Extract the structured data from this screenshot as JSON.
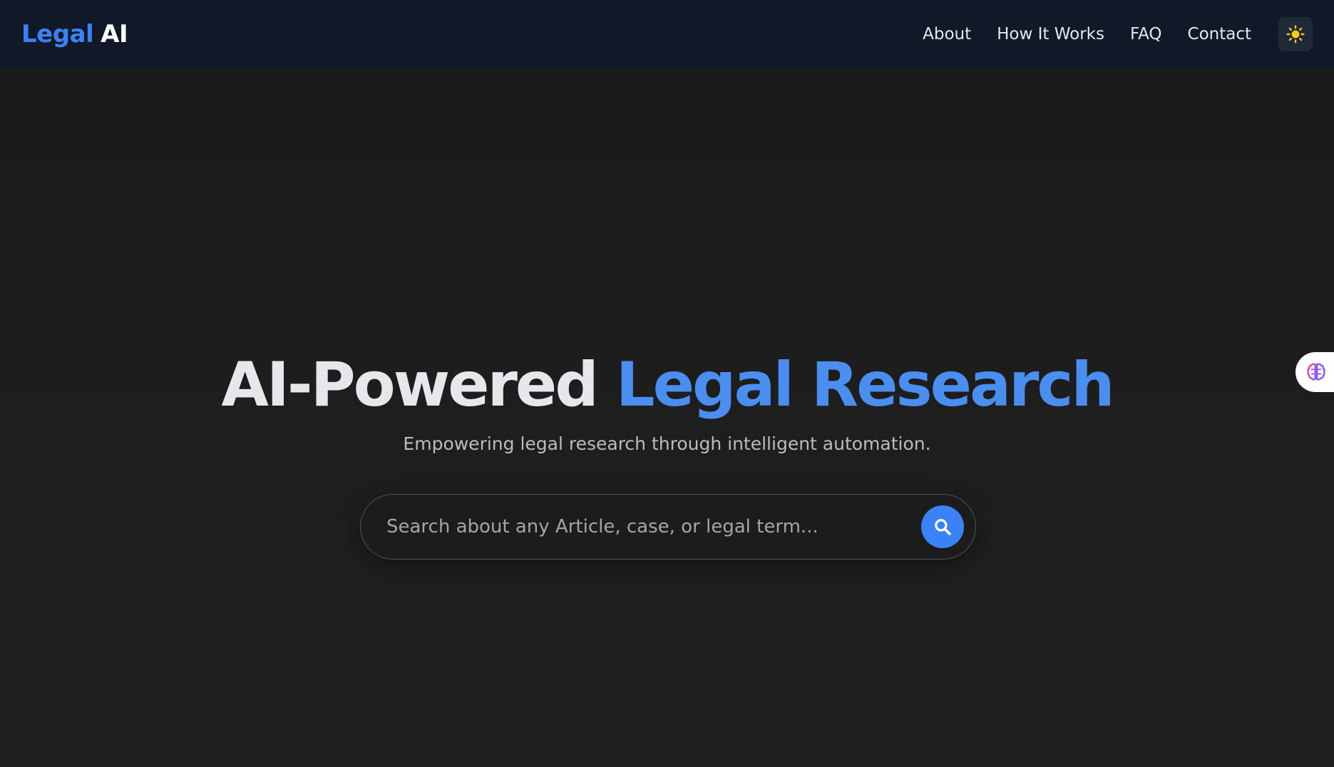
{
  "navbar": {
    "brand_part1": "Legal",
    "brand_part2": "AI",
    "links": [
      "About",
      "How It Works",
      "FAQ",
      "Contact"
    ],
    "theme_toggle_icon": "sun-icon"
  },
  "hero": {
    "title_part1": "AI-Powered",
    "title_part2": "Legal Research",
    "subtitle": "Empowering legal research through intelligent automation.",
    "search": {
      "placeholder": "Search about any Article, case, or legal term...",
      "value": "",
      "button_icon": "search-icon"
    }
  },
  "side_widget": {
    "icon": "brain-icon"
  },
  "colors": {
    "accent": "#3b82f6",
    "navbar_bg": "#111827",
    "page_bg": "#1c1c1c",
    "sun": "#facc15"
  }
}
